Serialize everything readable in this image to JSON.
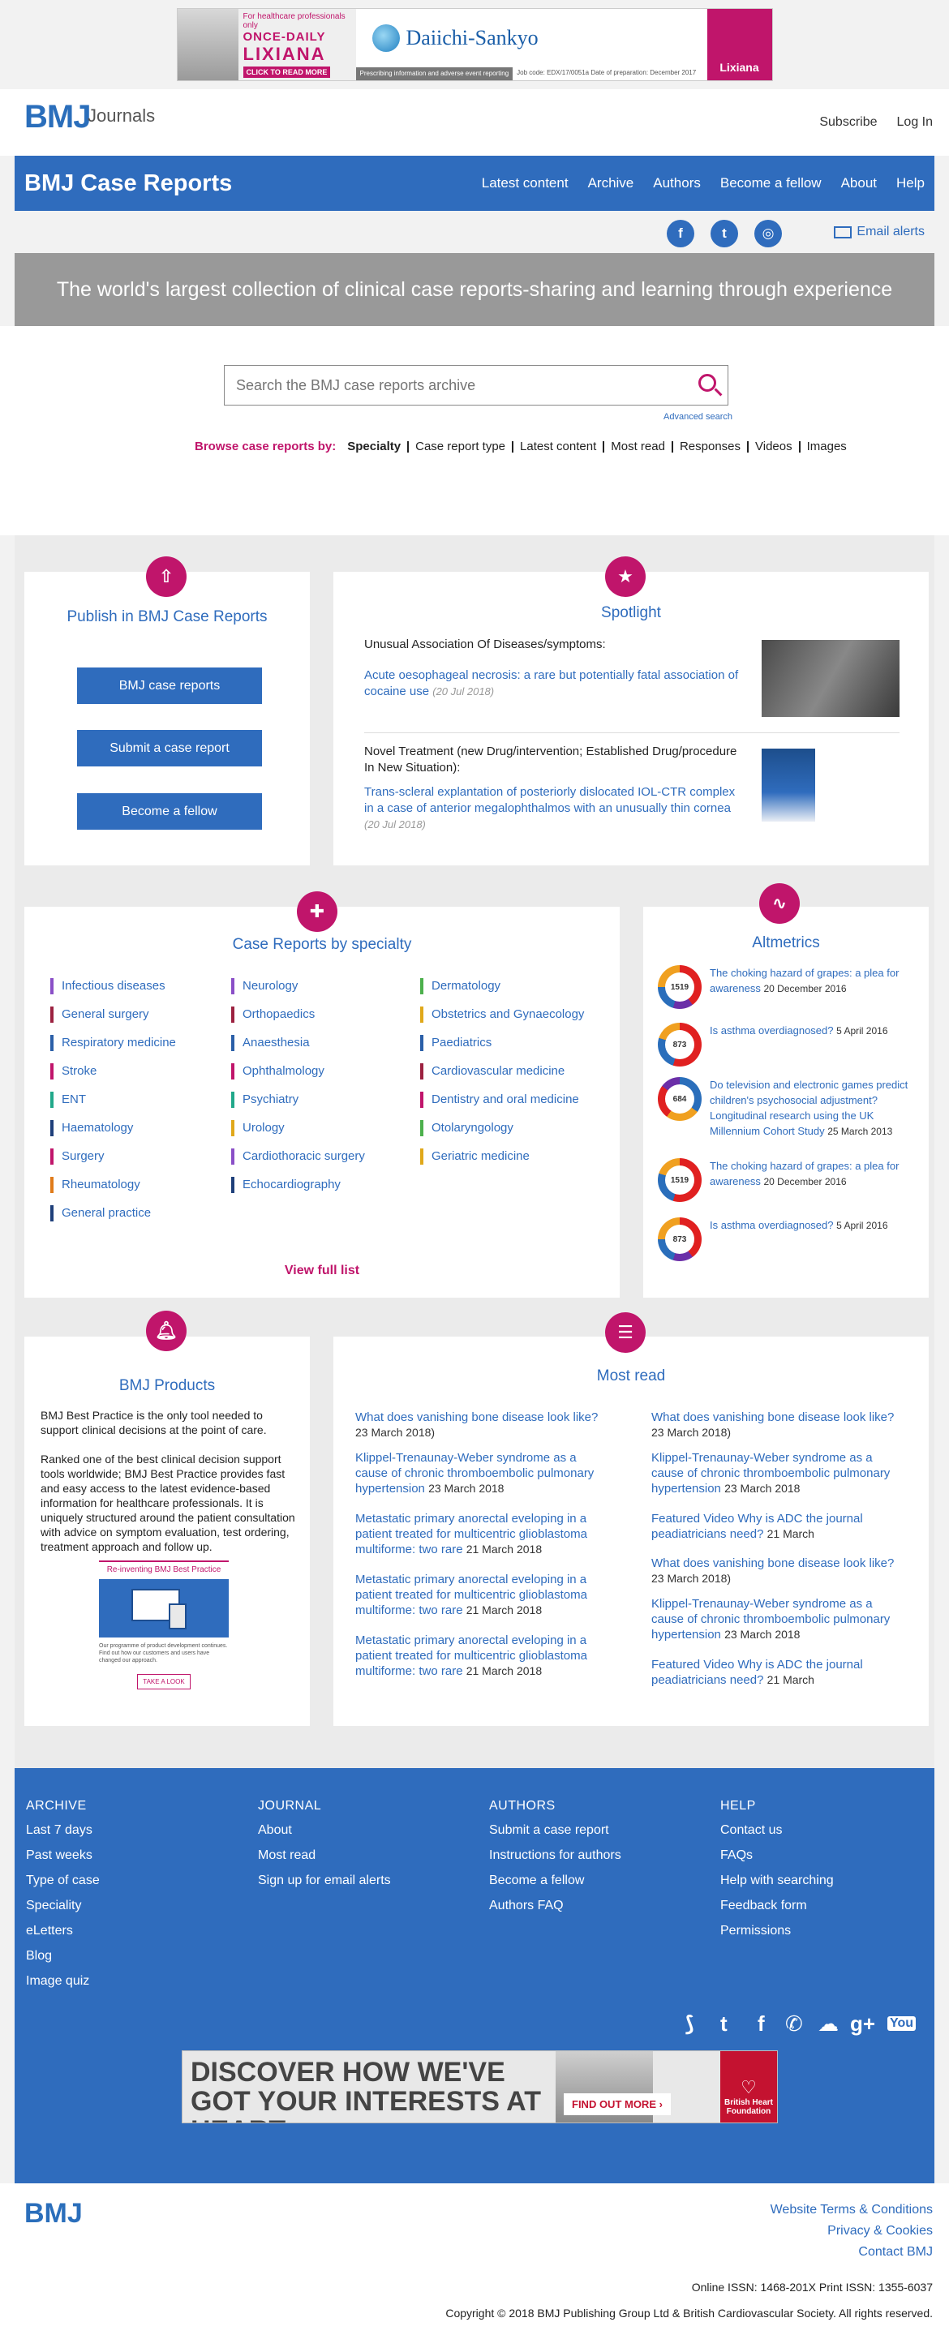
{
  "top_ad": {
    "hcp": "For healthcare professionals only",
    "once_daily": "ONCE-DAILY",
    "lixiana": "LIXIANA",
    "cta": "CLICK TO READ MORE",
    "brand": "Daiichi-Sankyo",
    "pi": "Prescribing information and adverse event reporting",
    "job_code": "Job code: EDX/17/0051a",
    "prep_date": "Date of preparation: December 2017",
    "right_brand": "Lixiana"
  },
  "header": {
    "logo_bmj": "BMJ",
    "logo_journals": "Journals",
    "subscribe": "Subscribe",
    "login": "Log In"
  },
  "nav": {
    "brand": "BMJ Case Reports",
    "items": [
      "Latest content",
      "Archive",
      "Authors",
      "Become a fellow",
      "About",
      "Help"
    ]
  },
  "social": {
    "facebook": "f",
    "twitter": "t",
    "podcast": "◎",
    "email_alerts": "Email alerts"
  },
  "hero": {
    "text": "The world's largest collection of clinical case reports-sharing and learning through experience"
  },
  "search": {
    "placeholder": "Search the BMJ case reports archive",
    "advanced": "Advanced search",
    "browse_label": "Browse case reports by:",
    "browse_items": [
      "Specialty",
      "Case report type",
      "Latest content",
      "Most read",
      "Responses",
      "Videos",
      "Images"
    ]
  },
  "publish": {
    "title": "Publish in BMJ Case Reports",
    "buttons": [
      "BMJ case reports",
      "Submit a case report",
      "Become a fellow"
    ]
  },
  "spotlight": {
    "title": "Spotlight",
    "items": [
      {
        "category": "Unusual Association Of Diseases/symptoms:",
        "link": "Acute oesophageal necrosis: a rare but potentially fatal association of cocaine use",
        "date": "(20 Jul 2018)"
      },
      {
        "category": "Novel Treatment (new Drug/intervention; Established Drug/procedure In New Situation):",
        "link": "Trans-scleral explantation of posteriorly dislocated IOL-CTR complex in a case of anterior megalophthalmos with an unusually thin cornea",
        "date": "(20 Jul 2018)"
      }
    ]
  },
  "specialty": {
    "title": "Case Reports by specialty",
    "col1": [
      {
        "name": "Infectious diseases",
        "color": "#8a4fc7"
      },
      {
        "name": "General surgery",
        "color": "#9c2140"
      },
      {
        "name": "Respiratory medicine",
        "color": "#2b5fa8"
      },
      {
        "name": "Stroke",
        "color": "#c0156b"
      },
      {
        "name": "ENT",
        "color": "#21a88a"
      },
      {
        "name": "Haematology",
        "color": "#1e3f7a"
      },
      {
        "name": "Surgery",
        "color": "#c0156b"
      },
      {
        "name": "Rheumatology",
        "color": "#e07b1a"
      },
      {
        "name": "General practice",
        "color": "#1e3f7a"
      }
    ],
    "col2": [
      {
        "name": "Neurology",
        "color": "#8a4fc7"
      },
      {
        "name": "Orthopaedics",
        "color": "#9c2140"
      },
      {
        "name": "Anaesthesia",
        "color": "#2b5fa8"
      },
      {
        "name": "Ophthalmology",
        "color": "#c0156b"
      },
      {
        "name": "Psychiatry",
        "color": "#21a88a"
      },
      {
        "name": "Urology",
        "color": "#e0a81a"
      },
      {
        "name": "Cardiothoracic surgery",
        "color": "#8a4fc7"
      },
      {
        "name": "Echocardiography",
        "color": "#1e3f7a"
      }
    ],
    "col3": [
      {
        "name": "Dermatology",
        "color": "#4cb04c"
      },
      {
        "name": "Obstetrics and Gynaecology",
        "color": "#e0a81a"
      },
      {
        "name": "Paediatrics",
        "color": "#2b5fa8"
      },
      {
        "name": "Cardiovascular medicine",
        "color": "#9c2140"
      },
      {
        "name": "Dentistry and oral medicine",
        "color": "#c0156b"
      },
      {
        "name": "Otolaryngology",
        "color": "#4cb04c"
      },
      {
        "name": "Geriatric medicine",
        "color": "#e0a81a"
      }
    ],
    "view_full": "View full list"
  },
  "altmetrics": {
    "title": "Altmetrics",
    "items": [
      {
        "score": "1519",
        "title": "The choking hazard of grapes: a plea for awareness",
        "date": "20 December 2016"
      },
      {
        "score": "873",
        "title": "Is asthma overdiagnosed?",
        "date": "5 April 2016"
      },
      {
        "score": "684",
        "title": "Do television and electronic games predict children's psychosocial adjustment? Longitudinal research using the UK Millennium Cohort Study",
        "date": "25 March 2013"
      },
      {
        "score": "1519",
        "title": "The choking hazard of grapes: a plea for awareness",
        "date": "20 December 2016"
      },
      {
        "score": "873",
        "title": "Is asthma overdiagnosed?",
        "date": "5 April 2016"
      }
    ]
  },
  "products": {
    "title": "BMJ Products",
    "para1": "BMJ Best Practice is the only tool needed to support clinical decisions at the point of care.",
    "para2": "Ranked one of the best clinical decision support tools worldwide; BMJ Best Practice provides fast and easy access to the latest evidence-based information for healthcare professionals. It is uniquely structured around the patient consultation with advice on symptom evaluation, test ordering, treatment approach and follow up.",
    "img_title": "Re-inventing BMJ Best Practice",
    "img_caption": "Our programme of product development continues. Find out how our customers and users have changed our approach.",
    "img_cta": "TAKE A LOOK"
  },
  "most_read": {
    "title": "Most read",
    "left": [
      {
        "title": "What does vanishing bone disease look like?",
        "date": "23 March 2018)"
      },
      {
        "title": "Klippel-Trenaunay-Weber syndrome as a cause of chronic thromboembolic pulmonary hypertension",
        "date": "23 March 2018"
      },
      {
        "title": "Metastatic primary anorectal eveloping in a patient treated for multicentric glioblastoma multiforme: two rare",
        "date": "21 March 2018"
      },
      {
        "title": "Metastatic primary anorectal eveloping in a patient treated for multicentric glioblastoma multiforme: two rare",
        "date": "21 March 2018"
      },
      {
        "title": "Metastatic primary anorectal eveloping in a patient treated for multicentric glioblastoma multiforme: two rare",
        "date": "21 March 2018"
      }
    ],
    "right": [
      {
        "title": "What does vanishing bone disease look like?",
        "date": "23 March 2018)"
      },
      {
        "title": "Klippel-Trenaunay-Weber syndrome as a cause of chronic thromboembolic pulmonary hypertension",
        "date": "23 March 2018"
      },
      {
        "title": "Featured Video Why is ADC the journal peadiatricians need?",
        "date": "21 March"
      },
      {
        "title": "What does vanishing bone disease look like?",
        "date": "23 March 2018)"
      },
      {
        "title": "Klippel-Trenaunay-Weber syndrome as a cause of chronic thromboembolic pulmonary hypertension",
        "date": "23 March 2018"
      },
      {
        "title": "Featured Video Why is ADC the journal peadiatricians need?",
        "date": "21 March"
      }
    ]
  },
  "footer": {
    "archive": {
      "head": "ARCHIVE",
      "links": [
        "Last 7 days",
        "Past weeks",
        "Type of case",
        "Speciality",
        "eLetters",
        "Blog",
        "Image quiz"
      ]
    },
    "journal": {
      "head": "JOURNAL",
      "links": [
        "About",
        "Most read",
        "Sign up for email alerts"
      ]
    },
    "authors": {
      "head": "AUTHORS",
      "links": [
        "Submit a case report",
        "Instructions for authors",
        "Become a fellow",
        "Authors FAQ"
      ]
    },
    "help": {
      "head": "HELP",
      "links": [
        "Contact us",
        "FAQs",
        "Help with searching",
        "Feedback form",
        "Permissions"
      ]
    },
    "social": [
      "⟆",
      "t",
      "f",
      "✆",
      "☁",
      "g+",
      "You"
    ],
    "ad_text": "DISCOVER HOW WE'VE GOT YOUR INTERESTS AT HEART.",
    "ad_cta": "FIND OUT MORE ›",
    "ad_brand": "British Heart Foundation"
  },
  "bottom": {
    "logo": "BMJ",
    "links": [
      "Website Terms & Conditions",
      "Privacy & Cookies",
      "Contact BMJ"
    ],
    "issn": "Online ISSN: 1468-201X Print ISSN: 1355-6037",
    "copyright": "Copyright © 2018 BMJ Publishing Group Ltd & British Cardiovascular Society. All rights reserved."
  },
  "colors": {
    "primary": "#2f6cbd",
    "accent": "#c0156b",
    "hero": "#999999"
  }
}
